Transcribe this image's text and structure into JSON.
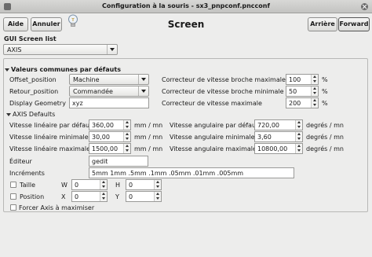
{
  "window": {
    "title": "Configuration à la souris - sx3_pnpconf.pncconf"
  },
  "toolbar": {
    "help_label": "Aide",
    "cancel_label": "Annuler",
    "back_label": "Arrière",
    "forward_label": "Forward"
  },
  "page": {
    "title": "Screen"
  },
  "gui": {
    "section_label": "GUI Screen list",
    "selected": "AXIS"
  },
  "common": {
    "header": "Valeurs communes par défauts",
    "offset_label": "Offset_position",
    "offset_value": "Machine",
    "retour_label": "Retour_position",
    "retour_value": "Commandée",
    "geometry_label": "Display Geometry",
    "geometry_value": "xyz",
    "spindle_max_label": "Correcteur de vitesse broche maximale",
    "spindle_max_value": "100",
    "spindle_max_unit": "%",
    "spindle_min_label": "Correcteur de vitesse broche minimale",
    "spindle_min_value": "50",
    "spindle_min_unit": "%",
    "feed_max_label": "Correcteur de vitesse maximale",
    "feed_max_value": "200",
    "feed_max_unit": "%"
  },
  "axis": {
    "header": "AXIS Defaults",
    "lin_default_label": "Vitesse linéaire par défaut",
    "lin_default_value": "360,00",
    "lin_default_unit": "mm / mn",
    "lin_min_label": "Vitesse linéaire minimale",
    "lin_min_value": "30,00",
    "lin_min_unit": "mm / mn",
    "lin_max_label": "Vitesse linéaire maximale",
    "lin_max_value": "1500,00",
    "lin_max_unit": "mm / mn",
    "ang_default_label": "Vitesse angulaire par défaut",
    "ang_default_value": "720,00",
    "ang_default_unit": "degrés / mn",
    "ang_min_label": "Vitesse angulaire minimale",
    "ang_min_value": "3,60",
    "ang_min_unit": "degrés / mn",
    "ang_max_label": "Vitesse angulaire maximale",
    "ang_max_value": "10800,00",
    "ang_max_unit": "degrés / mn",
    "editor_label": "Éditeur",
    "editor_value": "gedit",
    "increments_label": "Incréments",
    "increments_value": "5mm 1mm .5mm .1mm .05mm .01mm .005mm",
    "size_label": "Taille",
    "w_label": "W",
    "w_value": "0",
    "h_label": "H",
    "h_value": "0",
    "position_label": "Position",
    "x_label": "X",
    "x_value": "0",
    "y_label": "Y",
    "y_value": "0",
    "force_max_label": "Forcer Axis à maximiser"
  }
}
